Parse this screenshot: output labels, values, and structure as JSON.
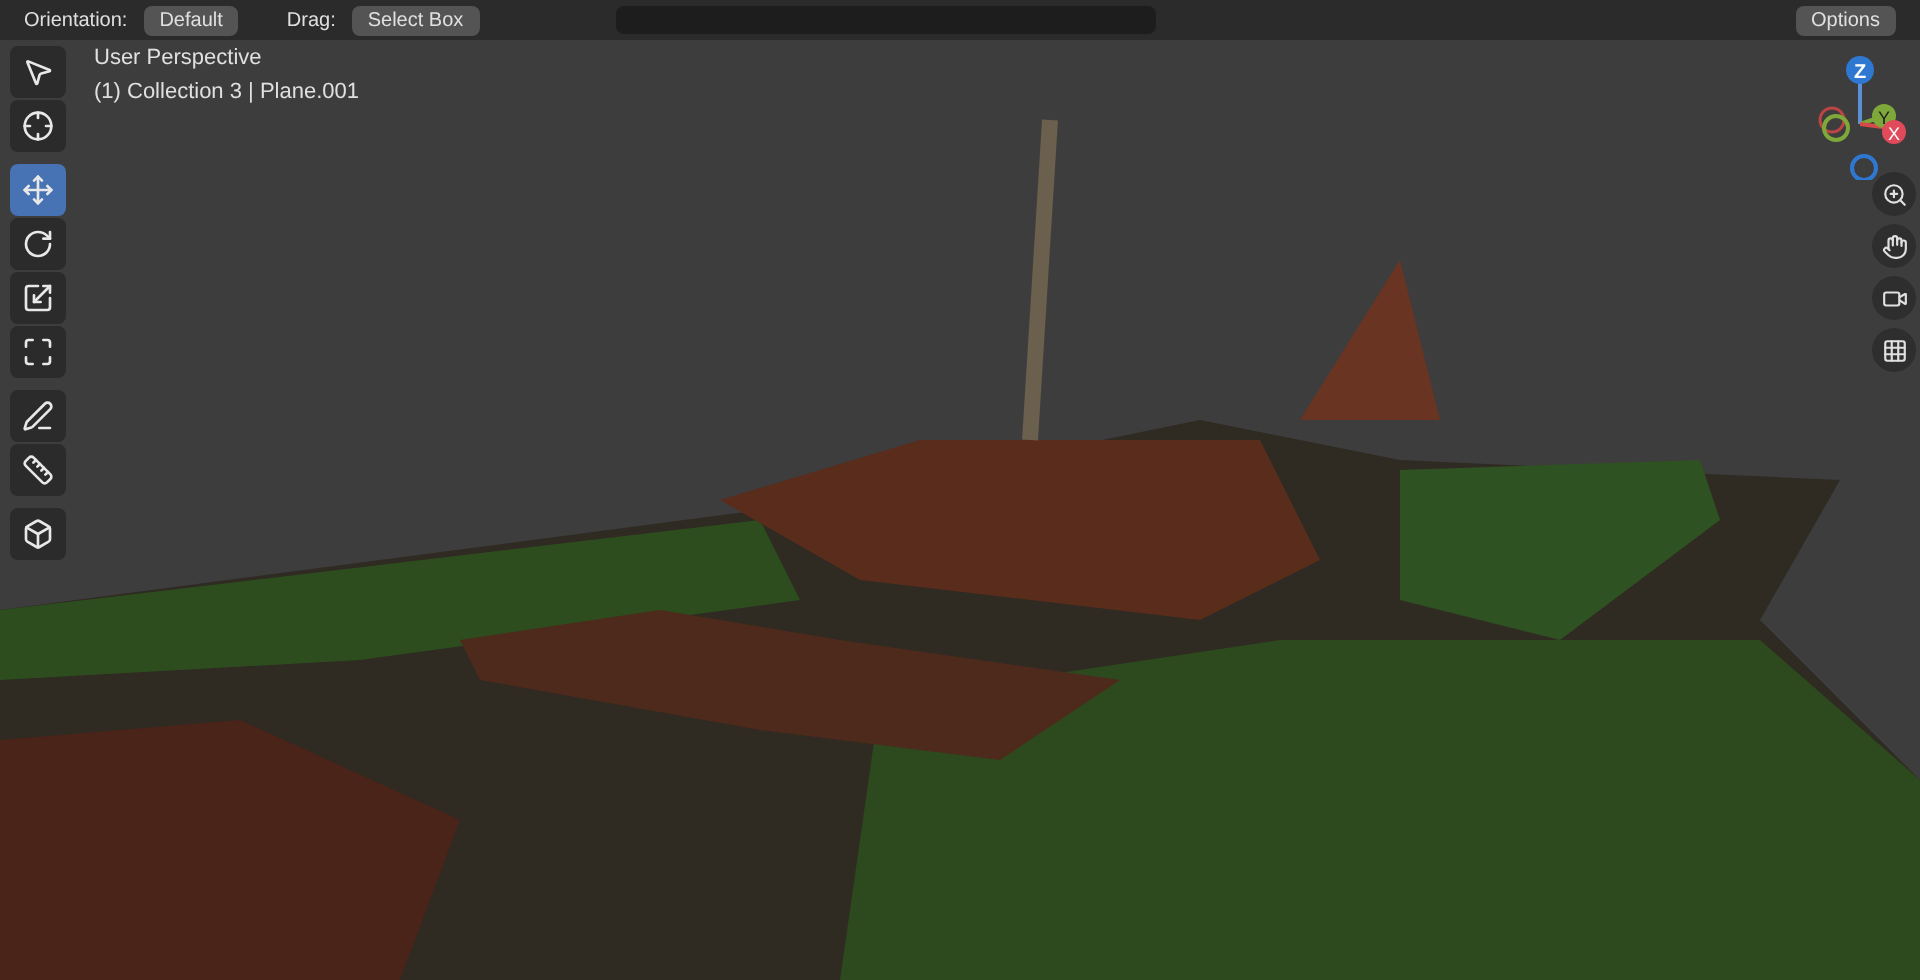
{
  "header": {
    "orientation_label": "Orientation:",
    "orientation_value": "Default",
    "drag_label": "Drag:",
    "drag_value": "Select Box",
    "options": "Options"
  },
  "viewport": {
    "view_name": "User Perspective",
    "object_info": "(1) Collection 3 | Plane.001"
  },
  "tools": [
    {
      "kind": "select",
      "selected": false
    },
    {
      "kind": "cursor",
      "selected": false
    },
    {
      "kind": "move",
      "selected": true
    },
    {
      "kind": "rotate",
      "selected": false
    },
    {
      "kind": "scale",
      "selected": false
    },
    {
      "kind": "transform",
      "selected": false
    },
    {
      "kind": "annotate",
      "selected": false
    },
    {
      "kind": "measure",
      "selected": false
    },
    {
      "kind": "add-cube",
      "selected": false
    }
  ],
  "gizmo": {
    "z": "Z",
    "y": "Y",
    "x": "X"
  },
  "nav": [
    {
      "kind": "zoom"
    },
    {
      "kind": "pan"
    },
    {
      "kind": "camera"
    },
    {
      "kind": "grid"
    }
  ]
}
